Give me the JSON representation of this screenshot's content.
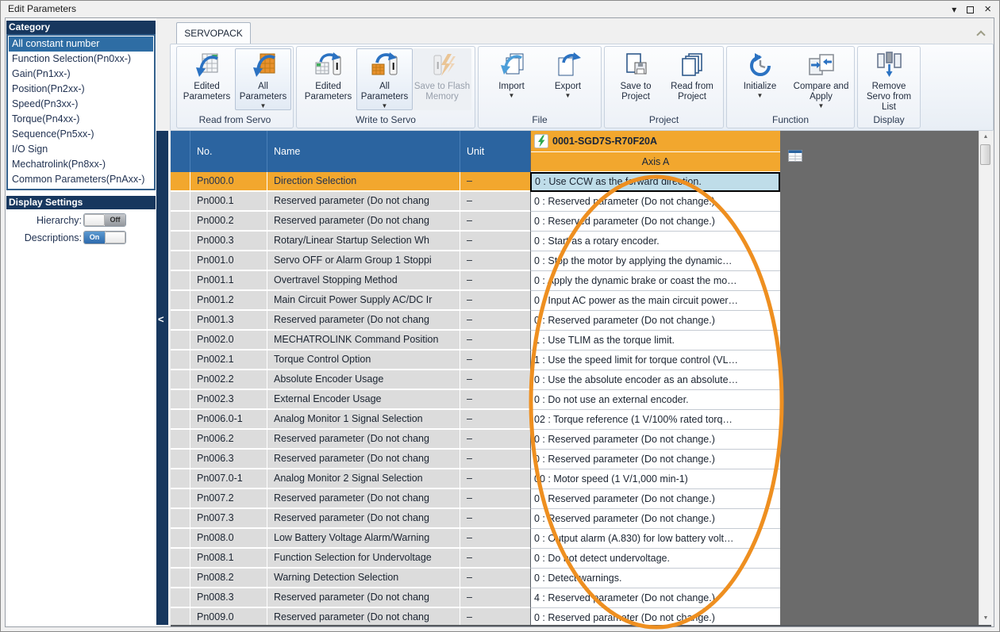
{
  "window": {
    "title": "Edit Parameters",
    "controls": {
      "menu": "menu",
      "maximize": "maximize",
      "close": "close"
    }
  },
  "sidebar": {
    "category": {
      "header": "Category",
      "items": [
        {
          "label": "All constant number",
          "selected": true
        },
        {
          "label": "Function Selection(Pn0xx-)"
        },
        {
          "label": "Gain(Pn1xx-)"
        },
        {
          "label": "Position(Pn2xx-)"
        },
        {
          "label": "Speed(Pn3xx-)"
        },
        {
          "label": "Torque(Pn4xx-)"
        },
        {
          "label": "Sequence(Pn5xx-)"
        },
        {
          "label": "I/O Sign"
        },
        {
          "label": "Mechatrolink(Pn8xx-)"
        },
        {
          "label": "Common Parameters(PnAxx-)"
        }
      ]
    },
    "display_settings": {
      "header": "Display Settings",
      "hierarchy_label": "Hierarchy:",
      "hierarchy_state": "Off",
      "descriptions_label": "Descriptions:",
      "descriptions_state": "On"
    }
  },
  "ribbon": {
    "tab": "SERVOPACK",
    "groups": [
      {
        "label": "Read from Servo",
        "buttons": [
          {
            "label": "Edited Parameters",
            "icon": "read-edited-parameters-icon"
          },
          {
            "label": "All Parameters",
            "icon": "read-all-parameters-icon",
            "dropdown": true,
            "highlighted": true
          }
        ]
      },
      {
        "label": "Write to Servo",
        "buttons": [
          {
            "label": "Edited Parameters",
            "icon": "write-edited-parameters-icon"
          },
          {
            "label": "All Parameters",
            "icon": "write-all-parameters-icon",
            "dropdown": true,
            "highlighted": true
          },
          {
            "label": "Save to Flash Memory",
            "icon": "save-to-flash-memory-icon",
            "disabled": true
          }
        ]
      },
      {
        "label": "File",
        "buttons": [
          {
            "label": "Import",
            "icon": "import-icon",
            "dropdown": true
          },
          {
            "label": "Export",
            "icon": "export-icon",
            "dropdown": true
          }
        ]
      },
      {
        "label": "Project",
        "buttons": [
          {
            "label": "Save to Project",
            "icon": "save-to-project-icon"
          },
          {
            "label": "Read from Project",
            "icon": "read-from-project-icon"
          }
        ]
      },
      {
        "label": "Function",
        "buttons": [
          {
            "label": "Initialize",
            "icon": "initialize-icon",
            "dropdown": true
          },
          {
            "label": "Compare and Apply",
            "icon": "compare-and-apply-icon",
            "dropdown": true
          }
        ]
      },
      {
        "label": "Display",
        "buttons": [
          {
            "label": "Remove Servo from List",
            "icon": "remove-servo-from-list-icon"
          }
        ]
      }
    ]
  },
  "table": {
    "columns": {
      "no": "No.",
      "name": "Name",
      "unit": "Unit"
    },
    "servo_header": {
      "id": "0001-SGD7S-R70F20A",
      "axis": "Axis A",
      "status_icon": "green-lightning-icon"
    },
    "rows": [
      {
        "no": "Pn000.0",
        "name": "Direction Selection",
        "unit": "–",
        "value": "0 : Use CCW as the forward direction.",
        "selected": true
      },
      {
        "no": "Pn000.1",
        "name": "Reserved parameter (Do not chang",
        "unit": "–",
        "value": "0 : Reserved parameter (Do not change.)"
      },
      {
        "no": "Pn000.2",
        "name": "Reserved parameter (Do not chang",
        "unit": "–",
        "value": "0 : Reserved parameter (Do not change.)"
      },
      {
        "no": "Pn000.3",
        "name": "Rotary/Linear Startup Selection Wh",
        "unit": "–",
        "value": "0 : Start as a rotary encoder."
      },
      {
        "no": "Pn001.0",
        "name": "Servo OFF or Alarm Group 1 Stoppi",
        "unit": "–",
        "value": "0 : Stop the motor by applying the dynamic…"
      },
      {
        "no": "Pn001.1",
        "name": "Overtravel Stopping Method",
        "unit": "–",
        "value": "0 : Apply the dynamic brake or coast the mo…"
      },
      {
        "no": "Pn001.2",
        "name": "Main Circuit Power Supply AC/DC Ir",
        "unit": "–",
        "value": "0 : Input AC power as the main circuit power…"
      },
      {
        "no": "Pn001.3",
        "name": "Reserved parameter (Do not chang",
        "unit": "–",
        "value": "0 : Reserved parameter (Do not change.)"
      },
      {
        "no": "Pn002.0",
        "name": "MECHATROLINK Command Position",
        "unit": "–",
        "value": "1 : Use TLIM as the torque limit."
      },
      {
        "no": "Pn002.1",
        "name": "Torque Control Option",
        "unit": "–",
        "value": "1 : Use the speed limit for torque control (VL…"
      },
      {
        "no": "Pn002.2",
        "name": "Absolute Encoder Usage",
        "unit": "–",
        "value": "0 : Use the absolute encoder as an absolute…"
      },
      {
        "no": "Pn002.3",
        "name": "External Encoder Usage",
        "unit": "–",
        "value": "0 : Do not use an external encoder."
      },
      {
        "no": "Pn006.0-1",
        "name": "Analog Monitor 1 Signal Selection",
        "unit": "–",
        "value": "02 : Torque reference (1 V/100% rated torq…"
      },
      {
        "no": "Pn006.2",
        "name": "Reserved parameter (Do not chang",
        "unit": "–",
        "value": "0 : Reserved parameter (Do not change.)"
      },
      {
        "no": "Pn006.3",
        "name": "Reserved parameter (Do not chang",
        "unit": "–",
        "value": "0 : Reserved parameter (Do not change.)"
      },
      {
        "no": "Pn007.0-1",
        "name": "Analog Monitor 2 Signal Selection",
        "unit": "–",
        "value": "00 : Motor speed (1 V/1,000 min-1)"
      },
      {
        "no": "Pn007.2",
        "name": "Reserved parameter (Do not chang",
        "unit": "–",
        "value": "0 : Reserved parameter (Do not change.)"
      },
      {
        "no": "Pn007.3",
        "name": "Reserved parameter (Do not chang",
        "unit": "–",
        "value": "0 : Reserved parameter (Do not change.)"
      },
      {
        "no": "Pn008.0",
        "name": "Low Battery Voltage Alarm/Warning",
        "unit": "–",
        "value": "0 : Output alarm (A.830) for low battery volt…"
      },
      {
        "no": "Pn008.1",
        "name": "Function Selection for Undervoltage",
        "unit": "–",
        "value": "0 : Do not detect undervoltage."
      },
      {
        "no": "Pn008.2",
        "name": "Warning Detection Selection",
        "unit": "–",
        "value": "0 : Detect warnings."
      },
      {
        "no": "Pn008.3",
        "name": "Reserved parameter (Do not chang",
        "unit": "–",
        "value": "4 : Reserved parameter (Do not change.)"
      },
      {
        "no": "Pn009.0",
        "name": "Reserved parameter (Do not chang",
        "unit": "–",
        "value": "0 : Reserved parameter (Do not change.)"
      }
    ]
  },
  "annotation": {
    "type": "ellipse-highlight",
    "color": "#EE8F20"
  },
  "colors": {
    "accent_orange": "#F2A72E",
    "header_blue": "#2B64A0",
    "navy": "#17375E",
    "selection_blue": "#2E6DA4",
    "selected_cell_blue": "#BFDDE9",
    "panel_gray": "#6B6B6B",
    "annotation_orange": "#EE8F20"
  }
}
